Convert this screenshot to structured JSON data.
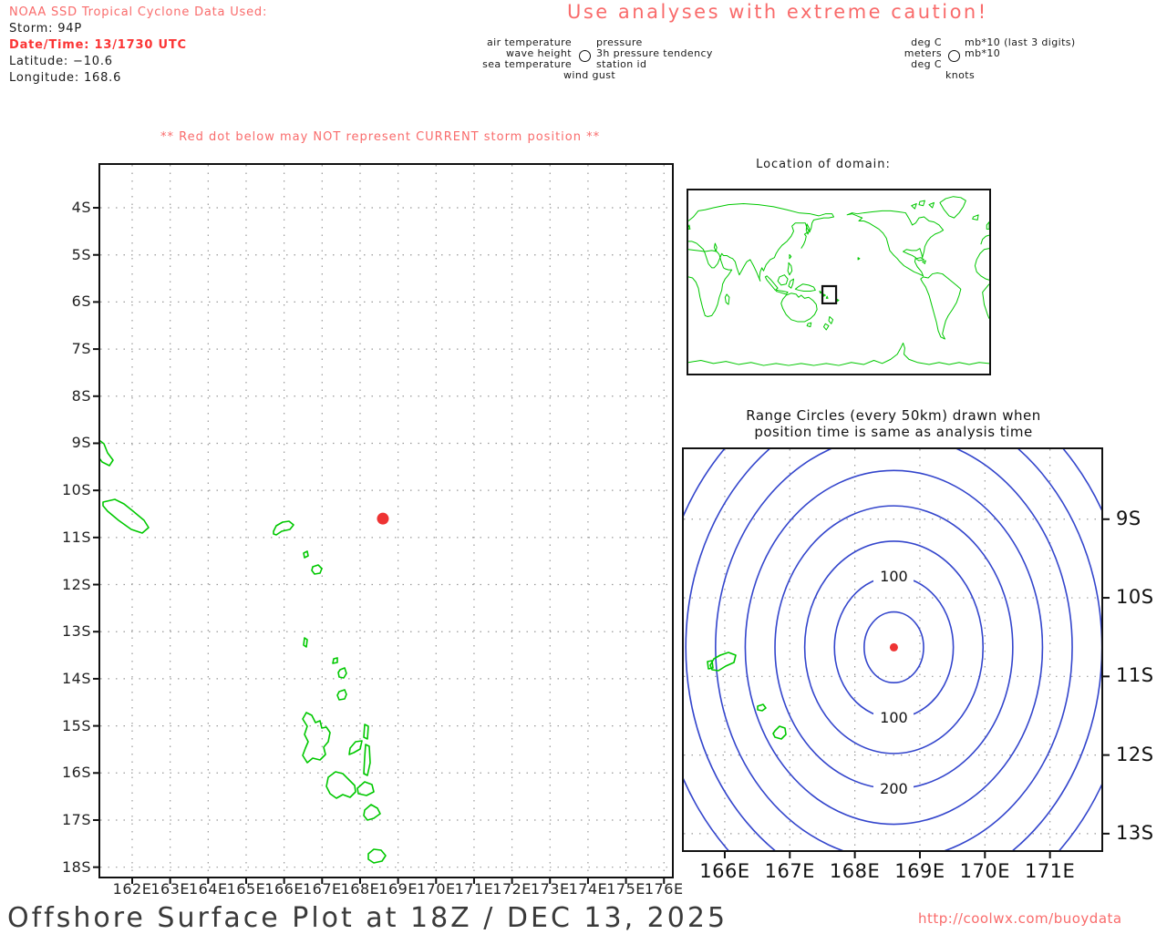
{
  "header": {
    "storm_info_title": "NOAA SSD Tropical Cyclone Data Used:",
    "storm_line": "Storm: 94P",
    "datetime_line": "Date/Time: 13/1730 UTC",
    "latitude_line": "Latitude: −10.6",
    "longitude_line": "Longitude: 168.6",
    "caution": "Use analyses with extreme caution!"
  },
  "station_model": {
    "left_labels": [
      "air temperature",
      "wave height",
      "sea temperature"
    ],
    "bottom_label": "wind gust",
    "right_labels": [
      "pressure",
      "3h pressure tendency",
      "station id"
    ],
    "units_left": [
      "deg C",
      "meters",
      "deg C"
    ],
    "units_bottom": "knots",
    "units_right": [
      "mb*10 (last 3 digits)",
      "mb*10"
    ]
  },
  "warning": "** Red dot below may NOT represent CURRENT storm position **",
  "domain_map": {
    "title": "Location of domain:"
  },
  "main_map": {
    "lat_ticks": [
      "4S",
      "5S",
      "6S",
      "7S",
      "8S",
      "9S",
      "10S",
      "11S",
      "12S",
      "13S",
      "14S",
      "15S",
      "16S",
      "17S",
      "18S"
    ],
    "lon_ticks": [
      "162E",
      "163E",
      "164E",
      "165E",
      "166E",
      "167E",
      "168E",
      "169E",
      "170E",
      "171E",
      "172E",
      "173E",
      "174E",
      "175E",
      "176E"
    ]
  },
  "range_plot": {
    "title_line1": "Range Circles (every 50km) drawn when",
    "title_line2": "position time is same as analysis time",
    "contour_labels": [
      "100",
      "100",
      "200"
    ],
    "lon_ticks": [
      "166E",
      "167E",
      "168E",
      "169E",
      "170E",
      "171E"
    ],
    "lat_ticks": [
      "9S",
      "10S",
      "11S",
      "12S",
      "13S"
    ]
  },
  "footer": {
    "title": "Offshore Surface Plot at 18Z / DEC 13, 2025",
    "url": "http://coolwx.com/buoydata"
  },
  "colors": {
    "warning_salmon": "#f96b6b",
    "bold_red": "#fb3434",
    "coast_green": "#00c800",
    "circle_blue": "#3345cc",
    "storm_red": "#ee3333",
    "grid_gray": "#999999"
  },
  "chart_data": [
    {
      "type": "scatter",
      "title": "Offshore surface plot domain map",
      "hemisphere": "S lat, E lon",
      "lon_range": [
        161.16,
        176.21
      ],
      "lat_range": [
        3.09,
        18.2
      ],
      "lon_gridlines": [
        162,
        163,
        164,
        165,
        166,
        167,
        168,
        169,
        170,
        171,
        172,
        173,
        174,
        175,
        176
      ],
      "lat_gridlines": [
        4,
        5,
        6,
        7,
        8,
        9,
        10,
        11,
        12,
        13,
        14,
        15,
        16,
        17,
        18
      ],
      "grid": "dotted",
      "storm_position": {
        "lon": 168.6,
        "lat": 10.6,
        "label": "94P"
      }
    },
    {
      "type": "contour",
      "title": "Range circles every 50 km from storm position",
      "lon_range": [
        165.37,
        171.79
      ],
      "lat_range": [
        8.11,
        13.21
      ],
      "lon_gridlines": [
        166,
        167,
        168,
        169,
        170,
        171
      ],
      "lat_gridlines": [
        9,
        10,
        11,
        12,
        13
      ],
      "center": {
        "lon": 168.6,
        "lat": 10.63
      },
      "circle_interval_km": 50,
      "num_circles": 8,
      "label_specs": [
        {
          "km": 100,
          "dir": -1
        },
        {
          "km": 100,
          "dir": 1
        },
        {
          "km": 200,
          "dir": 1
        }
      ]
    }
  ]
}
